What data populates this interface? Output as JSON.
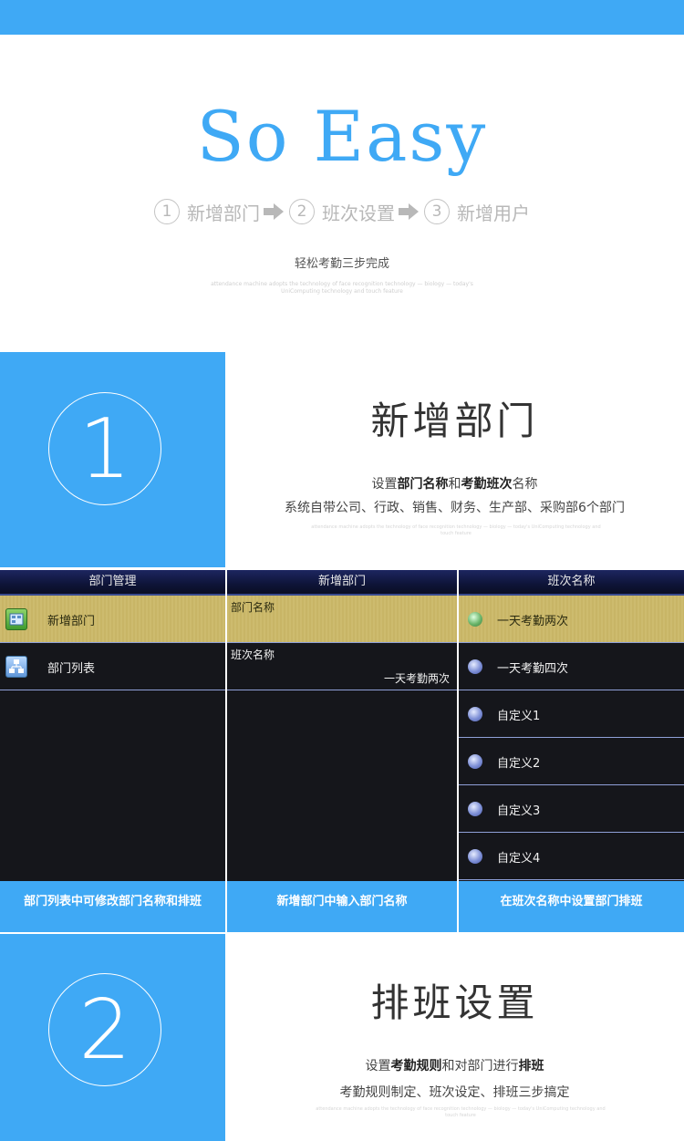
{
  "hero": {
    "title": "So Easy",
    "steps": [
      {
        "num": "1",
        "label": "新增部门"
      },
      {
        "num": "2",
        "label": "班次设置"
      },
      {
        "num": "3",
        "label": "新增用户"
      }
    ],
    "subtitle": "轻松考勤三步完成",
    "fine_text": "attendance machine adopts the technology of face recognition technology — biology — today's UniComputing technology and touch feature"
  },
  "section1": {
    "number": "1",
    "title": "新增部门",
    "line1_parts": [
      "设置",
      "部门名称",
      "和",
      "考勤班次",
      "名称"
    ],
    "line2": "系统自带公司、行政、销售、财务、生产部、采购部6个部门",
    "fine_text": "attendance machine adopts the technology of face recognition technology — biology — today's UniComputing technology and touch feature"
  },
  "screens": {
    "dept_mgmt": {
      "header": "部门管理",
      "items": [
        {
          "label": "新增部门",
          "icon": "add-department-icon"
        },
        {
          "label": "部门列表",
          "icon": "department-list-icon"
        }
      ]
    },
    "new_dept": {
      "header": "新增部门",
      "fields": [
        {
          "label": "部门名称",
          "value": ""
        },
        {
          "label": "班次名称",
          "value": "一天考勤两次"
        }
      ]
    },
    "shift_name": {
      "header": "班次名称",
      "options": [
        "一天考勤两次",
        "一天考勤四次",
        "自定义1",
        "自定义2",
        "自定义3",
        "自定义4"
      ]
    }
  },
  "captions": [
    "部门列表中可修改部门名称和排班",
    "新增部门中输入部门名称",
    "在班次名称中设置部门排班"
  ],
  "section2": {
    "number": "2",
    "title": "排班设置",
    "line1_parts": [
      "设置",
      "考勤规则",
      "和对部门进行",
      "排班"
    ],
    "line2": "考勤规则制定、班次设定、排班三步搞定",
    "fine_text": "attendance machine adopts the technology of face recognition technology — biology — today's UniComputing technology and touch feature"
  },
  "colors": {
    "accent": "#3fa9f5",
    "highlight": "#cdbb6e",
    "screen_bg": "#15161b"
  }
}
